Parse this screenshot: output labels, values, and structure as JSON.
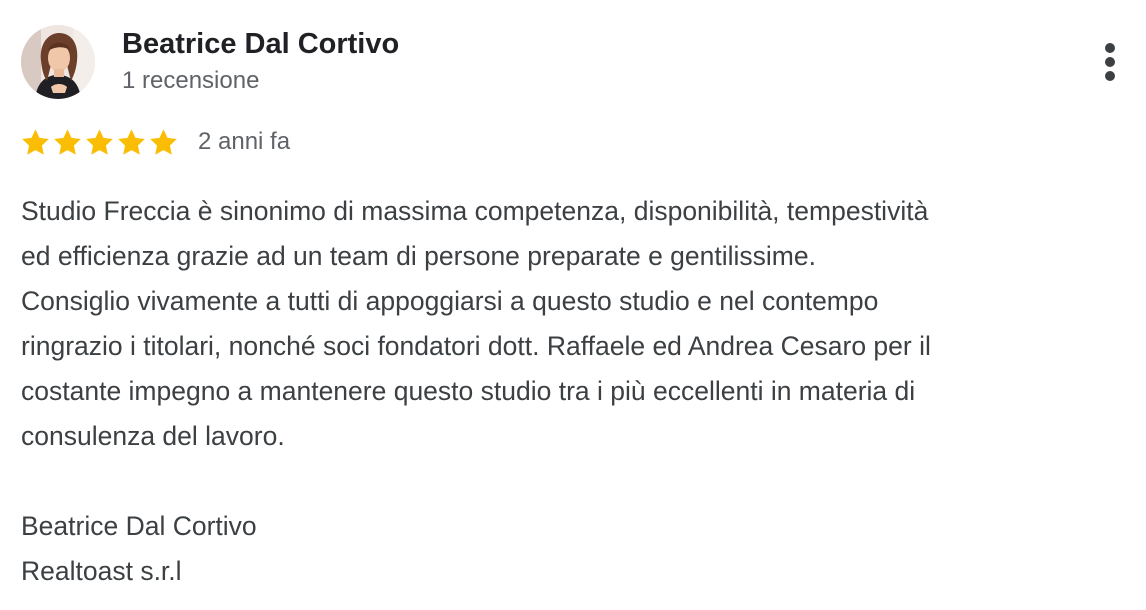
{
  "review": {
    "author": {
      "name": "Beatrice Dal Cortivo",
      "meta": "1 recensione"
    },
    "rating": {
      "stars": 5,
      "max": 5,
      "color": "#fbbc04"
    },
    "date": "2 anni fa",
    "text_lines": [
      "Studio Freccia è sinonimo di massima competenza, disponibilità, tempestività",
      "ed efficienza grazie ad un team di persone preparate e gentilissime.",
      "Consiglio vivamente a tutti di appoggiarsi a questo studio e nel contempo",
      "ringrazio i titolari, nonché soci fondatori dott. Raffaele ed Andrea Cesaro per il",
      "costante impegno a mantenere questo studio tra i più eccellenti in materia di",
      "consulenza del lavoro."
    ],
    "signature_lines": [
      "Beatrice Dal Cortivo",
      "Realtoast s.r.l"
    ],
    "menu_icon": "more-vert-icon"
  }
}
